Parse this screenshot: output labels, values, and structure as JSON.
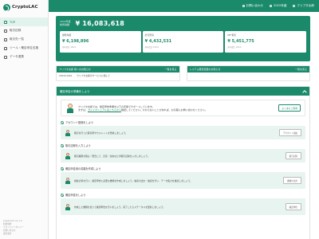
{
  "app": {
    "logo_text": "CryptoLAC"
  },
  "sidebar": {
    "items": [
      {
        "label": "TOP",
        "icon": "home-icon",
        "active": true
      },
      {
        "label": "取引記録",
        "icon": "list-icon"
      },
      {
        "label": "取引先一覧",
        "icon": "users-icon"
      },
      {
        "label": "ツール・確定申告支援",
        "icon": "tool-icon"
      },
      {
        "label": "データ連携",
        "icon": "link-icon"
      }
    ],
    "footer": [
      "CryptoLAC ver 1.0",
      "利用規約",
      "プライバシーポリシー",
      "お問い合わせ",
      "運営会社"
    ]
  },
  "topbar": {
    "items": [
      {
        "label": "お問い合わせ",
        "icon": "mail-icon"
      },
      {
        "label": "2022年度",
        "icon": "calendar-icon"
      },
      {
        "label": "クリプタ太郎",
        "icon": "user-icon"
      }
    ]
  },
  "summary": {
    "label_line1": "2022年度",
    "label_line2": "総所得額",
    "value": "¥ 16,083,618",
    "cards": [
      {
        "label": "雑所得額",
        "value": "¥ 6,198,896",
        "note": "前年度比 120.0"
      },
      {
        "label": "給与所得",
        "value": "¥ 4,432,531",
        "note": "前年度比 120.0"
      },
      {
        "label": "NFT取引",
        "value": "¥ 5,451,775",
        "note": "前年度比 120.0"
      }
    ]
  },
  "boxes": [
    {
      "title": "クリプタ太郎 様へのお知らせ",
      "link": "一覧を見る",
      "date": "2022/10/26",
      "text": "クリプタ太郎のサービスに関して"
    },
    {
      "title": "システム障害変更のお知らせ",
      "link": "一覧を見る",
      "date": "",
      "text": ""
    }
  ],
  "panel": {
    "title": "確定申告の準備をしよう",
    "intro_text_1": "クリプタ太郎では、確定申告準備を以下の手順でサポートしています。",
    "intro_text_2": "まずは、",
    "intro_link": "ガイドマニュアルはこちらから",
    "intro_text_3": "確認してください。わからないことがあれば、お気軽にお問い合わせください。",
    "intro_button": "よくあるご質問",
    "steps": [
      {
        "title": "アカウント登録をしよう",
        "text": "取引を行った取引所やウォレットを登録しましょう。",
        "button": "アカウント追加",
        "tall": false
      },
      {
        "title": "取引記録を入力しよう",
        "text": "取引履歴を取込・照合して、売買・交換などの取引記録を入力しましょう。",
        "button": "取引記録",
        "tall": false
      },
      {
        "title": "確定申告用の書類を作成しよう",
        "text": "損益計算を行い、確定申告に必要な書類を作成しましょう。帳票の出力・確認を行い、データ集計を確認しましょう。",
        "button": "書類の出力",
        "tall": true
      },
      {
        "title": "確定申告をしよう",
        "text": "作成した書類を使って確定申告を行いましょう。完了したらステータスを更新しましょう。",
        "button": "確定申告",
        "tall": true
      }
    ]
  },
  "colors": {
    "brand": "#1b8a6b",
    "brand_light": "#e8f4ef"
  }
}
